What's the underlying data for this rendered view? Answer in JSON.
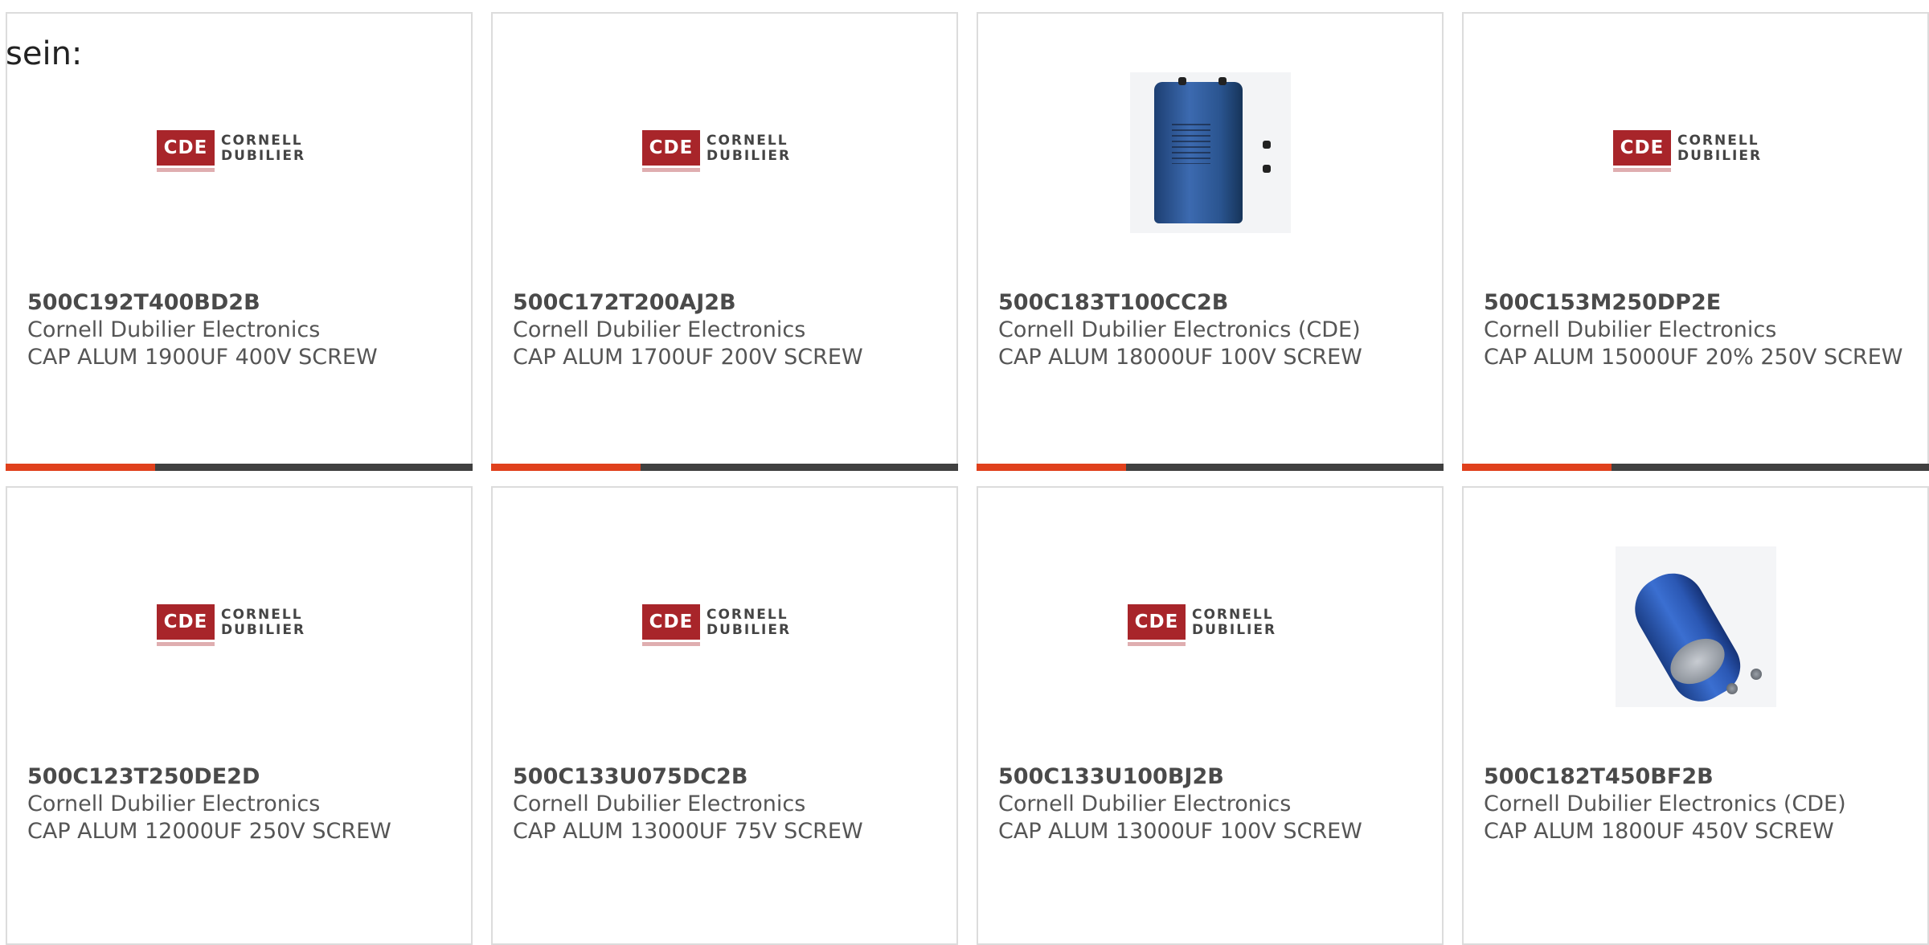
{
  "intro_text": "sein:",
  "colors": {
    "accent_bar": "#e0401c",
    "dark_bar": "#404040",
    "card_border": "#dcdcdc",
    "logo_red": "#a8252a"
  },
  "logo": {
    "abbr": "CDE",
    "line1": "CORNELL",
    "line2": "DUBILIER"
  },
  "products": [
    {
      "part_number": "500C192T400BD2B",
      "manufacturer": "Cornell Dubilier Electronics",
      "description": "CAP ALUM 1900UF 400V SCREW",
      "image": "cde-logo",
      "progress": 0.32
    },
    {
      "part_number": "500C172T200AJ2B",
      "manufacturer": "Cornell Dubilier Electronics",
      "description": "CAP ALUM 1700UF 200V SCREW",
      "image": "cde-logo",
      "progress": 0.32
    },
    {
      "part_number": "500C183T100CC2B",
      "manufacturer": "Cornell Dubilier Electronics (CDE)",
      "description": "CAP ALUM 18000UF 100V SCREW",
      "image": "capacitor-upright-photo",
      "progress": 0.32
    },
    {
      "part_number": "500C153M250DP2E",
      "manufacturer": "Cornell Dubilier Electronics",
      "description": "CAP ALUM 15000UF 20% 250V SCREW",
      "image": "cde-logo",
      "progress": 0.32
    },
    {
      "part_number": "500C123T250DE2D",
      "manufacturer": "Cornell Dubilier Electronics",
      "description": "CAP ALUM 12000UF 250V SCREW",
      "image": "cde-logo"
    },
    {
      "part_number": "500C133U075DC2B",
      "manufacturer": "Cornell Dubilier Electronics",
      "description": "CAP ALUM 13000UF 75V SCREW",
      "image": "cde-logo"
    },
    {
      "part_number": "500C133U100BJ2B",
      "manufacturer": "Cornell Dubilier Electronics",
      "description": "CAP ALUM 13000UF 100V SCREW",
      "image": "cde-logo"
    },
    {
      "part_number": "500C182T450BF2B",
      "manufacturer": "Cornell Dubilier Electronics (CDE)",
      "description": "CAP ALUM 1800UF 450V SCREW",
      "image": "capacitor-tilted-photo"
    }
  ]
}
